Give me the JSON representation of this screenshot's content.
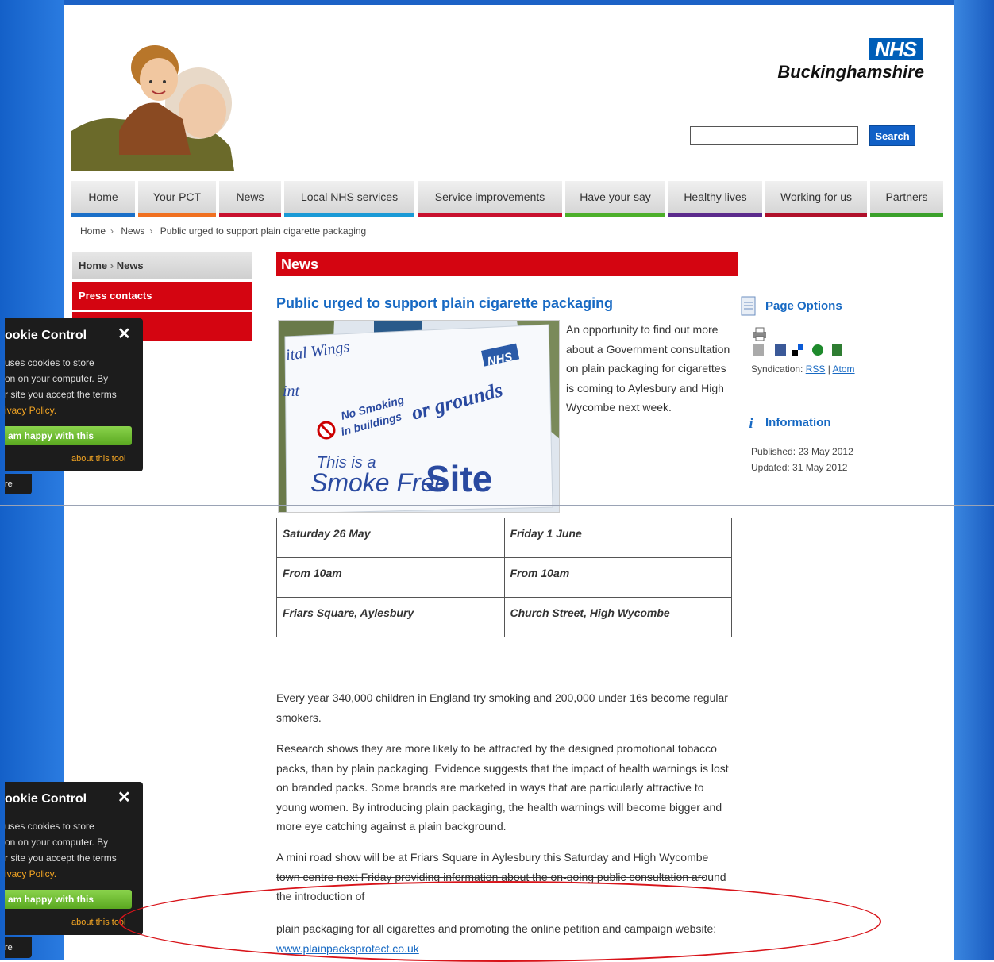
{
  "header": {
    "logo_nhs": "NHS",
    "logo_county": "Buckinghamshire",
    "search_button": "Search",
    "search_value": ""
  },
  "nav": [
    {
      "label": "Home",
      "color": "#1a6fc8"
    },
    {
      "label": "Your PCT",
      "color": "#f07020"
    },
    {
      "label": "News",
      "color": "#c8102e"
    },
    {
      "label": "Local NHS services",
      "color": "#1a9ad6"
    },
    {
      "label": "Service improvements",
      "color": "#c8102e"
    },
    {
      "label": "Have your say",
      "color": "#4caf2a"
    },
    {
      "label": "Healthy lives",
      "color": "#5b2a8c"
    },
    {
      "label": "Working for us",
      "color": "#b0102a"
    },
    {
      "label": "Partners",
      "color": "#3aa02a"
    }
  ],
  "breadcrumb": {
    "home": "Home",
    "news": "News",
    "current": "Public urged to support plain cigarette packaging"
  },
  "sidebar": {
    "crumb_home": "Home",
    "crumb_news": "News",
    "press_contacts": "Press contacts"
  },
  "cookie": {
    "title": "ookie Control",
    "close": "✕",
    "line1": "uses cookies to store",
    "line2": "on on your computer. By",
    "line3": "r site you accept the terms",
    "line4": "ivacy Policy.",
    "button": "am happy with this",
    "about": "about this tool",
    "tab": "re"
  },
  "main": {
    "section_title": "News",
    "article_title": "Public urged to support plain cigarette packaging",
    "intro": "An opportunity to find out more about a Government consultation on plain packaging for cigarettes is coming to Aylesbury and High Wycombe next week.",
    "image_text": {
      "wings": "ital Wings",
      "nt": "int",
      "nhs": "NHS",
      "no_smoking": "No Smoking",
      "in_buildings": "in buildings",
      "or_grounds": "or grounds",
      "this_is_a": "This is a",
      "smoke_free": "Smoke Free",
      "site": "Site"
    },
    "events": [
      [
        "Saturday 26 May",
        "Friday 1 June"
      ],
      [
        "From 10am",
        "From 10am"
      ],
      [
        "Friars Square, Aylesbury",
        "Church Street, High Wycombe"
      ]
    ],
    "para1": "Every year 340,000 children in England try smoking and 200,000 under 16s become regular smokers.",
    "para2": "Research shows they are more likely to be attracted by the designed promotional tobacco packs, than by plain packaging. Evidence suggests that the impact of health warnings is lost on branded packs. Some brands are marketed in ways that are particularly attractive to young women. By introducing plain packaging, the health warnings will become bigger and more eye catching against a plain background.",
    "para3a": "A mini road show will be at Friars Square in Aylesbury this Saturday and High Wycombe town centre next Friday providing information about the on-going public consultation around the introduction of",
    "para4": "plain packaging for all cigarettes and promoting the online petition and campaign website: ",
    "website": "www.plainpacksprotect.co.uk"
  },
  "right_col": {
    "page_options": "Page Options",
    "syndication": "Syndication: ",
    "rss": "RSS",
    "sep": " | ",
    "atom": "Atom",
    "information": "Information",
    "published": "Published: 23 May 2012",
    "updated": "Updated: 31 May 2012"
  }
}
